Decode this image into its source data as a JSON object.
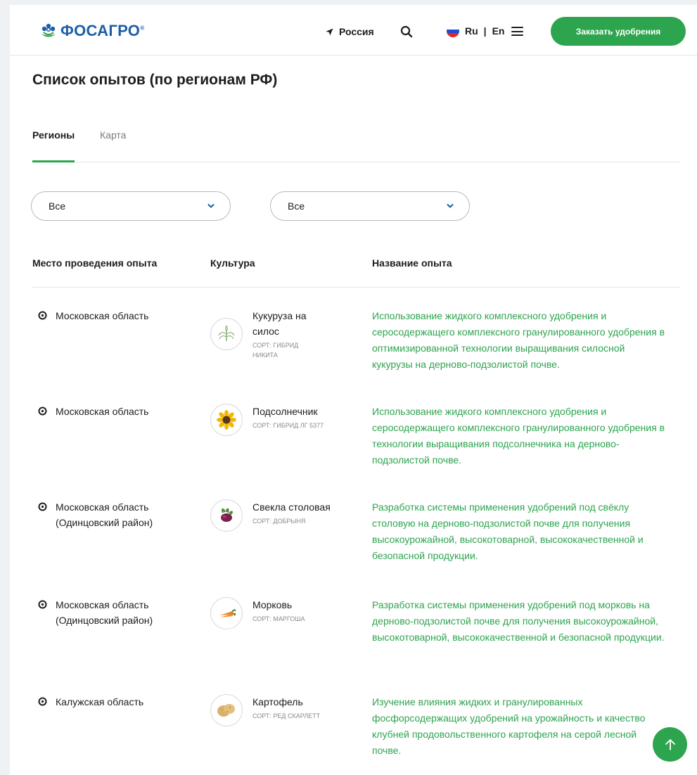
{
  "header": {
    "logo_text": "ФОСАГРО",
    "logo_mark": "®",
    "region_label": "Россия",
    "lang_ru": "Ru",
    "lang_sep": "|",
    "lang_en": "En",
    "order_button": "Заказать удобрения",
    "colors": {
      "brand_blue": "#1d5ea8",
      "accent_green": "#2da44e"
    }
  },
  "page": {
    "title": "Список опытов (по регионам РФ)"
  },
  "tabs": [
    {
      "label": "Регионы",
      "active": true
    },
    {
      "label": "Карта",
      "active": false
    }
  ],
  "filters": [
    {
      "value": "Все"
    },
    {
      "value": "Все"
    }
  ],
  "table": {
    "columns": [
      "Место проведения опыта",
      "Культура",
      "Название опыта"
    ],
    "rows": [
      {
        "place": "Московская область",
        "crop": "Кукуруза на силос",
        "crop_icon": "corn-icon",
        "sort": "Сорт: гибрид Никита",
        "trial": "Использование жидкого комплексного удобрения и серосодержащего комплексного гранулированного удобрения в оптимизированной технологии выращивания силосной кукурузы на дерново-подзолистой почве."
      },
      {
        "place": "Московская область",
        "crop": "Подсолнечник",
        "crop_icon": "sunflower-icon",
        "sort": "Сорт: гибрид ЛГ 5377",
        "trial": "Использование жидкого комплексного удобрения и серосодержащего комплексного гранулированного удобрения в технологии выращивания подсолнечника на дерново-подзолистой почве."
      },
      {
        "place": "Московская область (Одинцовский район)",
        "crop": "Свекла столовая",
        "crop_icon": "beet-icon",
        "sort": "Сорт: Добрыня",
        "trial": "Разработка системы применения удобрений под свёклу столовую на дерново-подзолистой почве для получения высокоурожайной, высокотоварной, высококачественной и безопасной продукции."
      },
      {
        "place": "Московская область (Одинцовский район)",
        "crop": "Морковь",
        "crop_icon": "carrot-icon",
        "sort": "Сорт: Маргоша",
        "trial": "Разработка системы применения удобрений под морковь на дерново-подзолистой почве для получения высокоурожайной, высокотоварной, высококачественной и безопасной продукции."
      },
      {
        "place": "Калужская область",
        "crop": "Картофель",
        "crop_icon": "potato-icon",
        "sort": "Сорт: Ред Скарлетт",
        "trial": "Изучение влияния жидких и гранулированных фосфорсодержащих удобрений на урожайность и качество клубней продовольственного картофеля на серой лесной почве."
      }
    ]
  }
}
